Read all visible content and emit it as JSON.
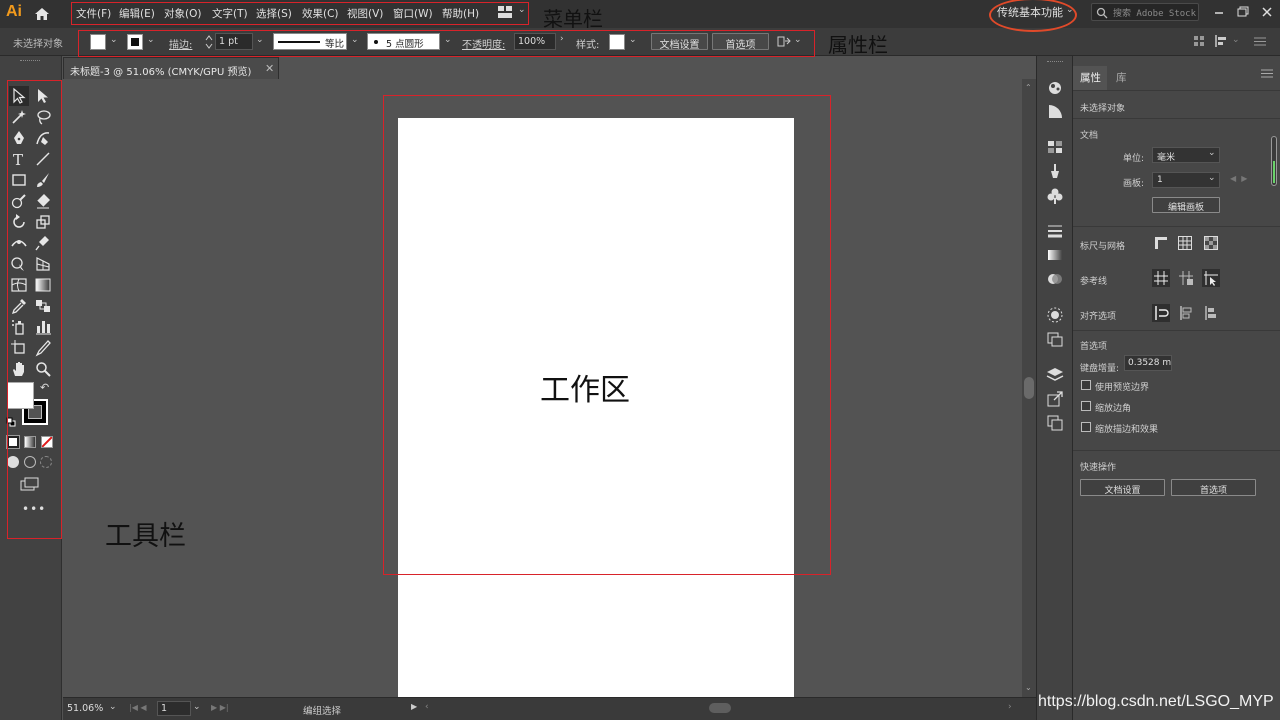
{
  "app": {
    "logo": "Ai"
  },
  "menu": {
    "items": [
      "文件(F)",
      "编辑(E)",
      "对象(O)",
      "文字(T)",
      "选择(S)",
      "效果(C)",
      "视图(V)",
      "窗口(W)",
      "帮助(H)"
    ],
    "workspace": "传统基本功能",
    "stock_placeholder": "搜索 Adobe Stock"
  },
  "control_bar": {
    "selection_state": "未选择对象",
    "stroke_label": "描边:",
    "stroke_weight": "1 pt",
    "stroke_profile": "等比",
    "brush": "5 点圆形",
    "opacity_label": "不透明度:",
    "opacity_value": "100%",
    "style_label": "样式:",
    "doc_setup_button": "文档设置",
    "prefs_button": "首选项"
  },
  "document": {
    "tab_title": "未标题-3 @ 51.06% (CMYK/GPU 预览)",
    "zoom": "51.06%",
    "artboard_number": "1",
    "status": "编组选择"
  },
  "properties_panel": {
    "tabs": [
      "属性",
      "库"
    ],
    "no_selection": "未选择对象",
    "document_section": "文档",
    "unit_label": "单位:",
    "unit_value": "毫米",
    "artboard_label": "画板:",
    "artboard_value": "1",
    "edit_artboard_button": "编辑画板",
    "rulers_grids": "标尺与网格",
    "guides": "参考线",
    "align_options": "对齐选项",
    "preferences_section": "首选项",
    "keyboard_increment_label": "键盘增量:",
    "keyboard_increment_value": "0.3528 m",
    "checkboxes": [
      "使用预览边界",
      "缩放边角",
      "缩放描边和效果"
    ],
    "quick_actions": "快速操作",
    "doc_setup_button": "文档设置",
    "prefs_button": "首选项"
  },
  "annotations": {
    "menubar": "菜单栏",
    "propertybar": "属性栏",
    "toolbar": "工具栏",
    "workspace": "工作区",
    "watermark": "https://blog.csdn.net/LSGO_MYP"
  },
  "colors": {
    "highlight": "#d8232a",
    "logo": "#f29a1c",
    "workspace_circle": "#e04a2a"
  }
}
